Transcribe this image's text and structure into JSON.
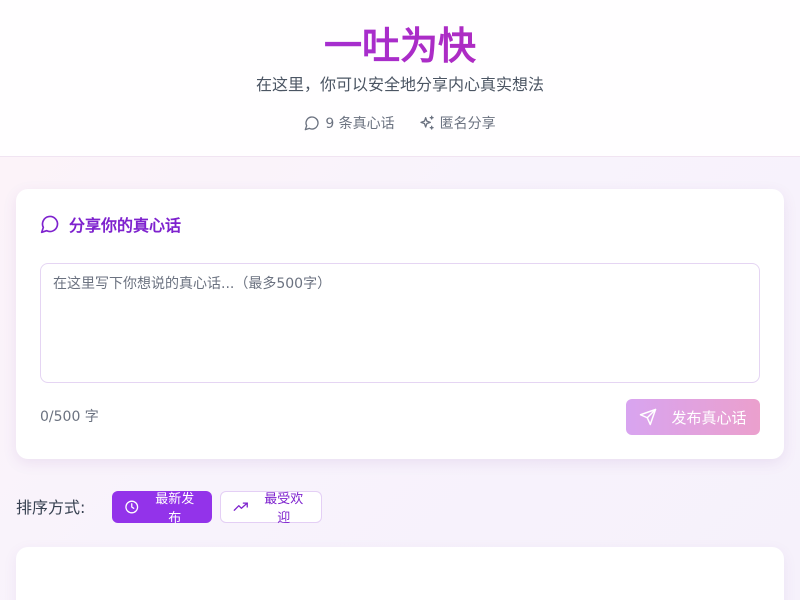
{
  "header": {
    "title": "一吐为快",
    "subtitle": "在这里，你可以安全地分享内心真实想法",
    "stats": {
      "count_label": "9 条真心话",
      "anonymous_label": "匿名分享"
    }
  },
  "composer": {
    "title": "分享你的真心话",
    "placeholder": "在这里写下你想说的真心话...（最多500字）",
    "value": "",
    "counter": "0/500 字",
    "publish_label": "发布真心话"
  },
  "sort": {
    "label": "排序方式:",
    "options": [
      {
        "label": "最新发布",
        "active": true
      },
      {
        "label": "最受欢迎",
        "active": false
      }
    ]
  },
  "icons": {
    "title_icon": "message-circle-icon",
    "count_icon": "message-circle-icon",
    "anonymous_icon": "sparkles-icon",
    "publish_icon": "send-icon",
    "latest_icon": "clock-icon",
    "popular_icon": "trending-up-icon"
  },
  "colors": {
    "accent": "#9333ea",
    "accent_pink": "#c026a8",
    "publish_gradient_start": "#d8a4f0",
    "publish_gradient_end": "#eba0cd"
  }
}
